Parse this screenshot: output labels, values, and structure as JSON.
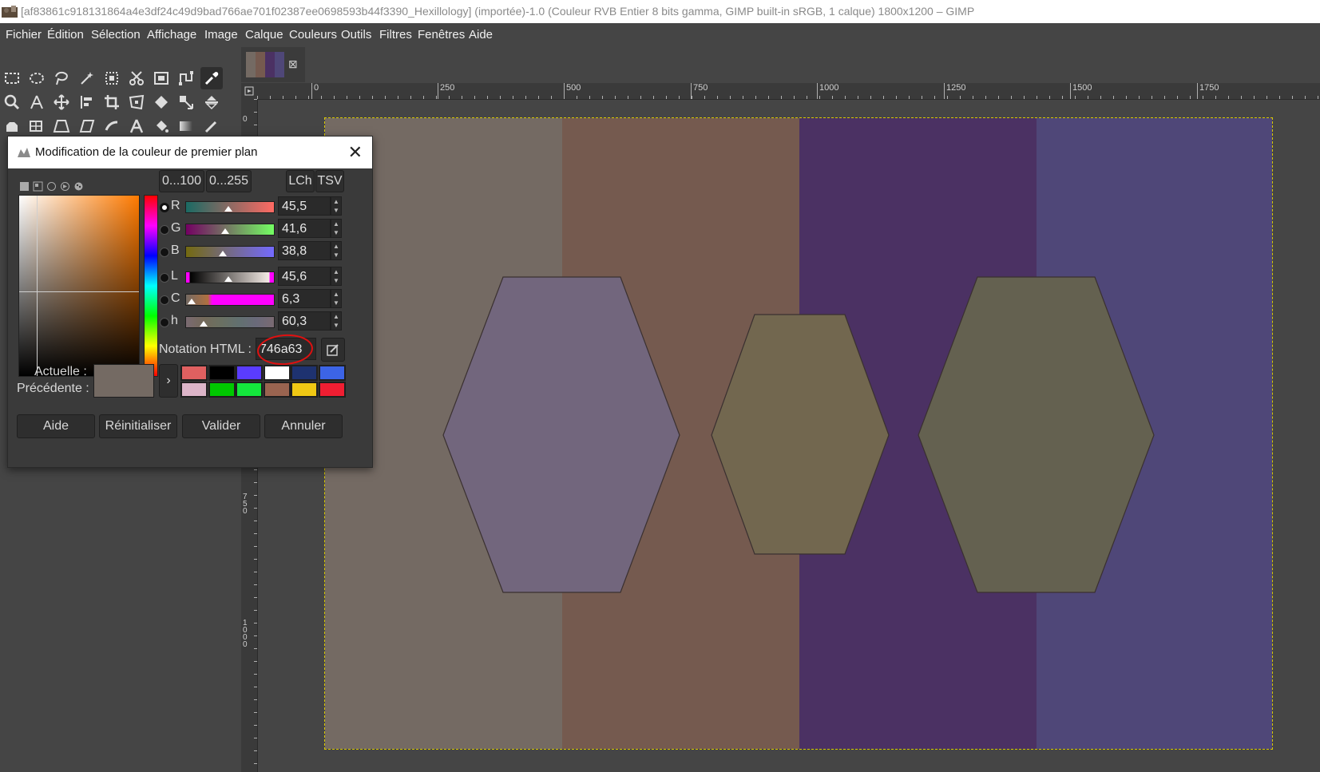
{
  "window": {
    "title": "[af83861c918131864a4e3df24c49d9bad766ae701f02387ee0698593b44f3390_Hexillology] (importée)-1.0 (Couleur RVB Entier 8 bits gamma, GIMP built-in sRGB, 1 calque) 1800x1200 – GIMP"
  },
  "menubar": [
    "Fichier",
    "Édition",
    "Sélection",
    "Affichage",
    "Image",
    "Calque",
    "Couleurs",
    "Outils",
    "Filtres",
    "Fenêtres",
    "Aide"
  ],
  "image_tab": {
    "close_glyph": "⊠"
  },
  "ruler": {
    "h_labels": [
      "0",
      "250",
      "500",
      "750",
      "1000",
      "1250",
      "1500",
      "1750"
    ],
    "v_labels": [
      "0",
      "7 5 0",
      "1 0 0 0"
    ]
  },
  "canvas": {
    "stripe_colors": [
      "#746a63",
      "#755a4f",
      "#4b3163",
      "#4f4778"
    ],
    "hexagon_colors": [
      "#72667d",
      "#72674f",
      "#646150"
    ],
    "hex_outline": "#3a3030"
  },
  "dialog": {
    "title": "Modification de la couleur de premier plan",
    "close_glyph": "✕",
    "range_buttons": [
      "0...100",
      "0...255"
    ],
    "model_buttons": [
      "LCh",
      "TSV"
    ],
    "channels": [
      {
        "label": "R",
        "value": "45,5",
        "selected": true
      },
      {
        "label": "G",
        "value": "41,6"
      },
      {
        "label": "B",
        "value": "38,8"
      },
      {
        "label": "L",
        "value": "45,6"
      },
      {
        "label": "C",
        "value": "6,3"
      },
      {
        "label": "h",
        "value": "60,3"
      }
    ],
    "html_label": "Notation HTML :",
    "html_value": "746a63",
    "current_label": "Actuelle :",
    "previous_label": "Précédente :",
    "current_color": "#746a63",
    "arrow_glyph": "›",
    "history": [
      "#e06060",
      "#000000",
      "#5a3cff",
      "#ffffff",
      "#1e3270",
      "#3c64e6",
      "#dcb4c8",
      "#00c800",
      "#14e63c",
      "#9a6450",
      "#f0c814",
      "#f01e32"
    ],
    "buttons": [
      "Aide",
      "Réinitialiser",
      "Valider",
      "Annuler"
    ]
  }
}
